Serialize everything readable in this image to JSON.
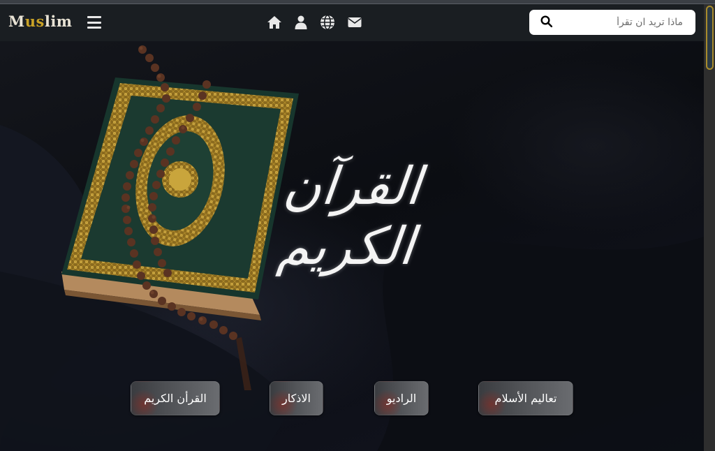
{
  "brand": {
    "part1": "M",
    "part2": "us",
    "part3": "lim"
  },
  "nav": {
    "icons": [
      "home-icon",
      "user-icon",
      "globe-icon",
      "envelope-icon"
    ]
  },
  "search": {
    "placeholder": "ماذا تريد ان تقرأ",
    "value": ""
  },
  "hero": {
    "title": "القرآن الكريم"
  },
  "cards": [
    {
      "label": "القرأن الكريم"
    },
    {
      "label": "الاذكار"
    },
    {
      "label": "الراديو"
    },
    {
      "label": "تعاليم الأسلام"
    }
  ],
  "colors": {
    "accent": "#c9a227",
    "navbar": "#1a1e22",
    "brand_text": "#e9e3d5"
  }
}
